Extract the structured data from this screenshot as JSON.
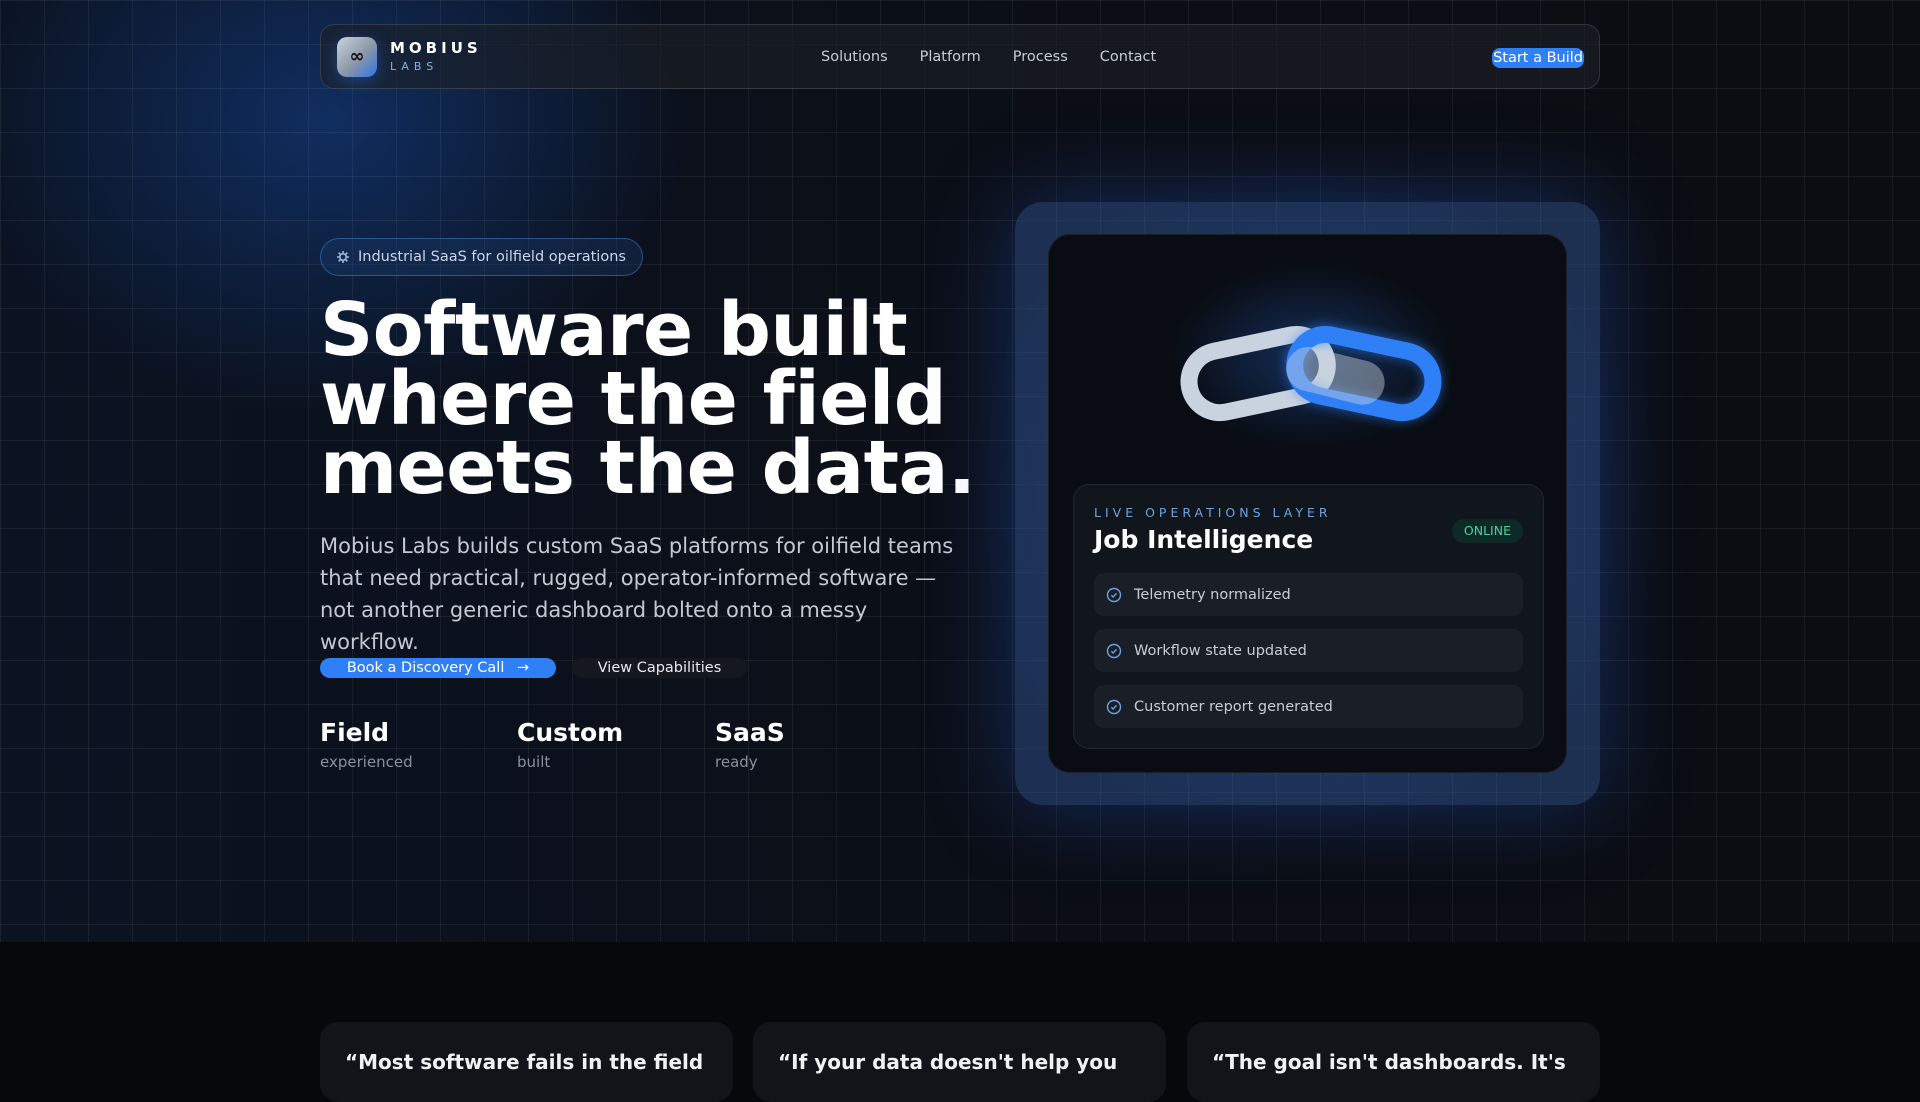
{
  "nav": {
    "brand": "MOBIUS",
    "brand_sub": "LABS",
    "logo_glyph": "∞",
    "links": [
      "Solutions",
      "Platform",
      "Process",
      "Contact"
    ],
    "cta": "Start a Build"
  },
  "hero": {
    "badge": "Industrial SaaS for oilfield operations",
    "headline": [
      "Software built",
      "where the field",
      "meets the data."
    ],
    "lede": "Mobius Labs builds custom SaaS platforms for oilfield teams that need practical, rugged, operator-informed software — not another generic dashboard bolted onto a messy workflow.",
    "primary_cta": "Book a Discovery Call",
    "secondary_cta": "View Capabilities",
    "stats": [
      {
        "title": "Field",
        "sub": "experienced"
      },
      {
        "title": "Custom",
        "sub": "built"
      },
      {
        "title": "SaaS",
        "sub": "ready"
      }
    ]
  },
  "panel": {
    "eyebrow": "LIVE OPERATIONS LAYER",
    "title": "Job Intelligence",
    "status": "ONLINE",
    "items": [
      "Telemetry normalized",
      "Workflow state updated",
      "Customer report generated"
    ]
  },
  "quotes": [
    "“Most software fails in the field",
    "“If your data doesn't help you",
    "“The goal isn't dashboards. It's"
  ],
  "colors": {
    "accent": "#2f7ff7",
    "online": "#47d49a",
    "bg": "#07080b"
  }
}
